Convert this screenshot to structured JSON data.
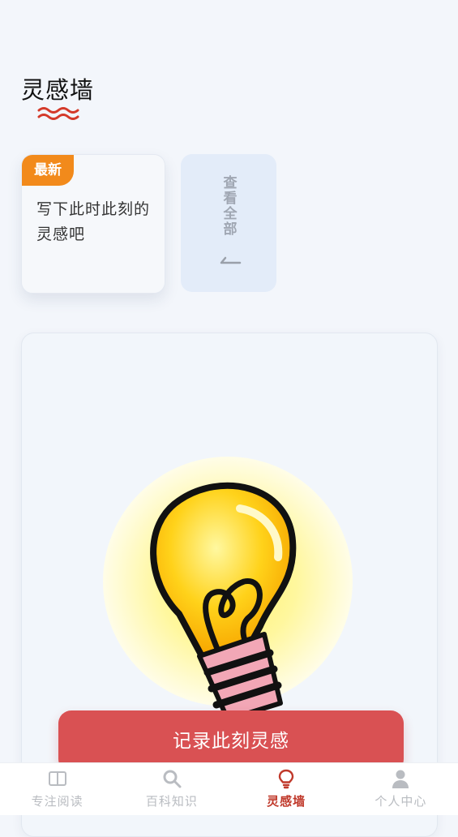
{
  "header": {
    "title": "灵感墙"
  },
  "latest_card": {
    "badge": "最新",
    "text": "写下此时此刻的灵感吧"
  },
  "view_all": {
    "label": "查看全部"
  },
  "actions": {
    "record_label": "记录此刻灵感"
  },
  "bottom_nav": {
    "items": [
      {
        "label": "专注阅读",
        "icon": "book-icon",
        "active": false
      },
      {
        "label": "百科知识",
        "icon": "search-icon",
        "active": false
      },
      {
        "label": "灵感墙",
        "icon": "lightbulb-icon",
        "active": true
      },
      {
        "label": "个人中心",
        "icon": "user-icon",
        "active": false
      }
    ]
  },
  "colors": {
    "accent": "#c0392b",
    "record_button": "#d95153",
    "badge": "#f28a1b",
    "inactive_nav": "#b9bcc1",
    "background": "#f3f6fb"
  }
}
